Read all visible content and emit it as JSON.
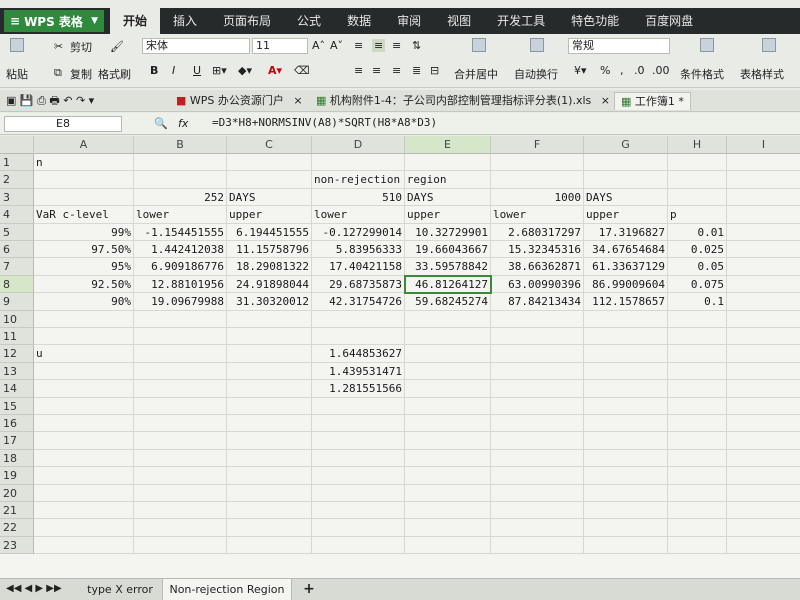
{
  "app": {
    "name": "WPS 表格"
  },
  "ribbon_tabs": [
    "开始",
    "插入",
    "页面布局",
    "公式",
    "数据",
    "审阅",
    "视图",
    "开发工具",
    "特色功能",
    "百度网盘"
  ],
  "ribbon": {
    "cut": "剪切",
    "paste": "粘贴",
    "copy": "复制",
    "format_painter": "格式刷",
    "font_name": "宋体",
    "font_size": "11",
    "merge_center": "合并居中",
    "wrap_text": "自动换行",
    "number_format": "常规",
    "cond_format": "条件格式",
    "table_style": "表格样式",
    "bold": "B",
    "italic": "I",
    "underline": "U"
  },
  "doc_tabs": [
    "WPS 办公资源门户",
    "机构附件1-4：子公司内部控制管理指标评分表(1).xls",
    "工作簿1 *"
  ],
  "formula_bar": {
    "name_box": "E8",
    "fx": "fx",
    "formula": "=D3*H8+NORMSINV(A8)*SQRT(H8*A8*D3)"
  },
  "columns": [
    "A",
    "B",
    "C",
    "D",
    "E",
    "F",
    "G",
    "H",
    "I"
  ],
  "rows": [
    "1",
    "2",
    "3",
    "4",
    "5",
    "6",
    "7",
    "8",
    "9",
    "10",
    "11",
    "12",
    "13",
    "14",
    "15",
    "16",
    "17",
    "18",
    "19",
    "20",
    "21",
    "22",
    "23"
  ],
  "cells": {
    "A1": "n",
    "D2": "non-rejection region",
    "B3": "252",
    "C3": "DAYS",
    "D3": "510",
    "E3": "DAYS",
    "F3": "1000",
    "G3": "DAYS",
    "A4": "VaR c-level",
    "B4": "lower",
    "C4": "upper",
    "D4": "lower",
    "E4": "upper",
    "F4": "lower",
    "G4": "upper",
    "H4": "p",
    "A5": "99%",
    "B5": "-1.154451555",
    "C5": "6.194451555",
    "D5": "-0.127299014",
    "E5": "10.32729901",
    "F5": "2.680317297",
    "G5": "17.3196827",
    "H5": "0.01",
    "A6": "97.50%",
    "B6": "1.442412038",
    "C6": "11.15758796",
    "D6": "5.83956333",
    "E6": "19.66043667",
    "F6": "15.32345316",
    "G6": "34.67654684",
    "H6": "0.025",
    "A7": "95%",
    "B7": "6.909186776",
    "C7": "18.29081322",
    "D7": "17.40421158",
    "E7": "33.59578842",
    "F7": "38.66362871",
    "G7": "61.33637129",
    "H7": "0.05",
    "A8": "92.50%",
    "B8": "12.88101956",
    "C8": "24.91898044",
    "D8": "29.68735873",
    "E8": "46.81264127",
    "F8": "63.00990396",
    "G8": "86.99009604",
    "H8": "0.075",
    "A9": "90%",
    "B9": "19.09679988",
    "C9": "31.30320012",
    "D9": "42.31754726",
    "E9": "59.68245274",
    "F9": "87.84213434",
    "G9": "112.1578657",
    "H9": "0.1",
    "A12": "u",
    "D12": "1.644853627",
    "D13": "1.439531471",
    "D14": "1.281551566"
  },
  "sheet_tabs": [
    "type X error",
    "Non-rejection Region",
    "+"
  ]
}
